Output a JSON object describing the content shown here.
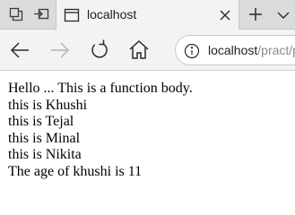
{
  "tab": {
    "title": "localhost"
  },
  "address_bar": {
    "host": "localhost",
    "path": "/pract/p"
  },
  "icons": {
    "tab_actions": "tab-actions-icon",
    "set_aside": "set-aside-tabs-icon",
    "favicon": "page-icon",
    "close": "close-icon",
    "new_tab": "plus-icon",
    "tabs_more": "chevron-down-icon",
    "back": "back-arrow-icon",
    "forward": "forward-arrow-icon",
    "refresh": "refresh-icon",
    "home": "home-icon",
    "site_info": "info-icon"
  },
  "page": {
    "lines": [
      "Hello ... This is a function body.",
      "this is Khushi",
      "this is Tejal",
      "this is Minal",
      "this is Nikita",
      "The age of khushi is 11"
    ]
  }
}
